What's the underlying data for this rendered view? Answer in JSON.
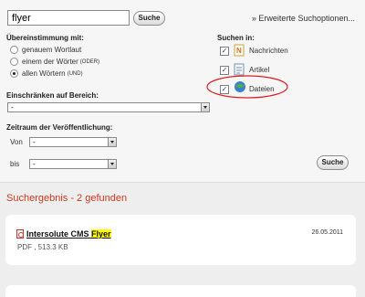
{
  "search": {
    "value": "flyer",
    "button": "Suche",
    "advanced_link": "» Erweiterte Suchoptionen..."
  },
  "match": {
    "label": "Übereinstimmung mit:",
    "options": [
      {
        "label": "genauem Wortlaut",
        "note": "",
        "selected": false
      },
      {
        "label": "einem der Wörter",
        "note": "(ODER)",
        "selected": false
      },
      {
        "label": "allen Wörtern",
        "note": "(UND)",
        "selected": true
      }
    ]
  },
  "search_in": {
    "label": "Suchen in:",
    "items": [
      {
        "label": "Nachrichten",
        "checked": true,
        "icon": "news-icon"
      },
      {
        "label": "Artikel",
        "checked": true,
        "icon": "article-icon"
      },
      {
        "label": "Dateien",
        "checked": true,
        "icon": "files-icon"
      }
    ]
  },
  "area": {
    "label": "Einschränken auf Bereich:",
    "value": "-"
  },
  "period": {
    "label": "Zeitraum der Veröffentlichung:",
    "from_label": "Von",
    "from_value": "-",
    "to_label": "bis",
    "to_value": "-"
  },
  "submit_button": "Suche",
  "results": {
    "heading": "Suchergebnis - 2 gefunden",
    "items": [
      {
        "title_prefix": "Intersolute CMS ",
        "title_highlight": "Flyer",
        "date": "26.05.2011",
        "meta": "PDF , 513.3 KB"
      }
    ]
  },
  "colors": {
    "accent": "#d03a1e",
    "highlight": "#ffff00",
    "annotation": "#e02020"
  }
}
